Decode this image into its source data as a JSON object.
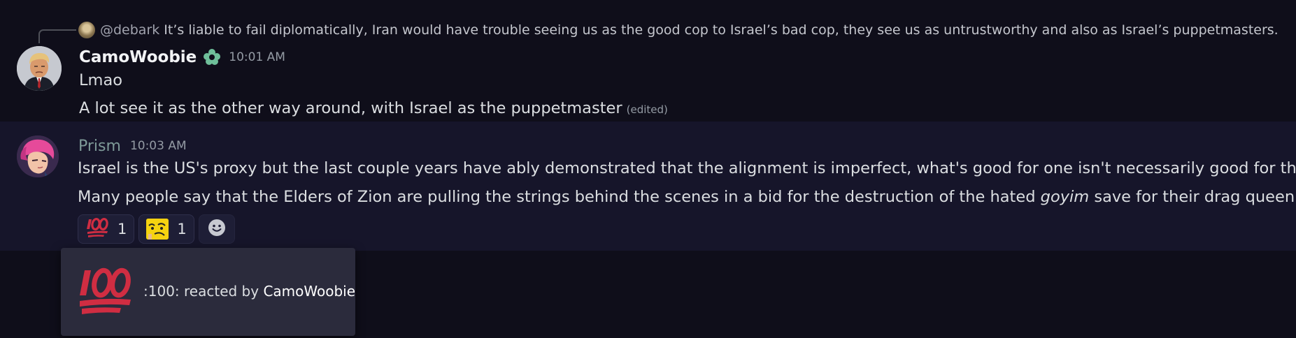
{
  "reply": {
    "user": "@debark",
    "text": "It’s liable to fail diplomatically, Iran would have trouble seeing us as the good cop to Israel’s bad cop, they see us as untrustworthy and also as Israel’s puppetmasters."
  },
  "messages": [
    {
      "username": "CamoWoobie",
      "badge_icon": "flower-badge-icon",
      "timestamp": "10:01 AM",
      "lines": [
        "Lmao",
        "A lot see it as the other way around, with Israel as the puppetmaster"
      ],
      "edited_label": "(edited)"
    },
    {
      "username": "Prism",
      "timestamp": "10:03 AM",
      "lines": [
        "Israel is the US's proxy but the last couple years have ably demonstrated that the alignment is imperfect, what's good for one isn't necessarily good for the other"
      ],
      "line2_before": "Many people say that the Elders of Zion are pulling the strings behind the scenes in a bid for the destruction of the hated ",
      "line2_italic": "goyim",
      "line2_after": " save for their drag queen allies",
      "reactions": [
        {
          "emoji": "100-icon",
          "count": "1"
        },
        {
          "emoji": "cursed-face-icon",
          "count": "1"
        }
      ],
      "add_reaction_icon": "add-reaction-smiley-icon"
    }
  ],
  "tooltip": {
    "prefix": ":100: reacted by ",
    "user": "CamoWoobie"
  },
  "colors": {
    "background": "#0f0e1a",
    "highlight": "#16152a",
    "hundred_red": "#d02d42",
    "badge_green": "#6fbf9a"
  }
}
